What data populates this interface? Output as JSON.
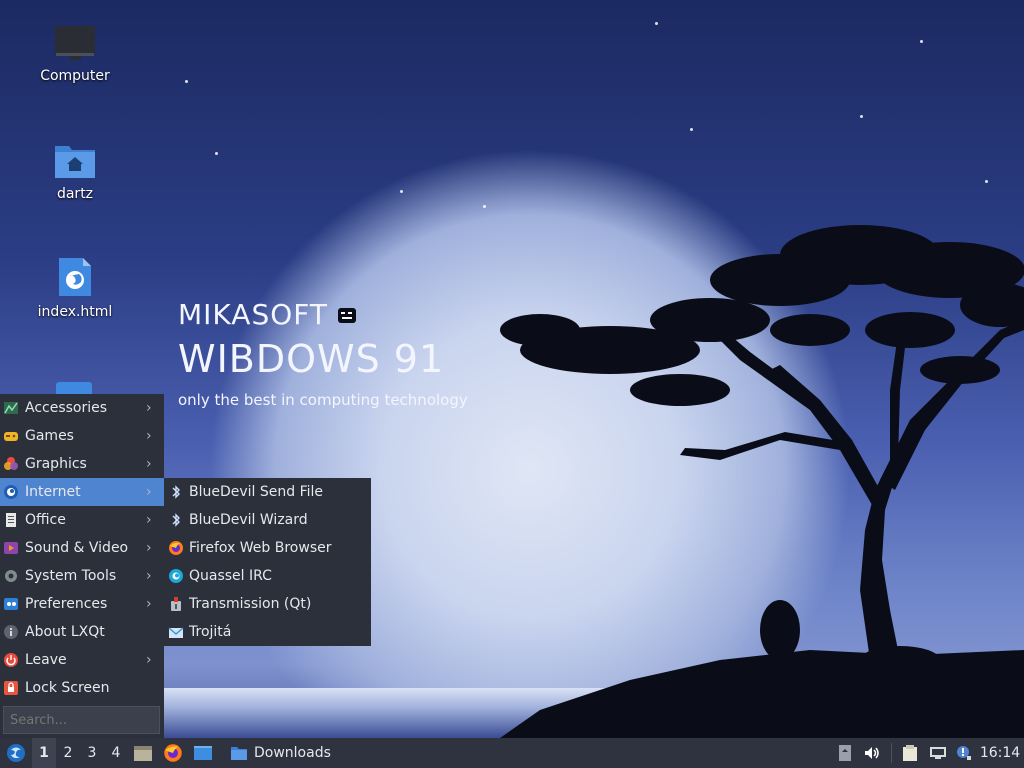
{
  "desktop": {
    "icons": [
      {
        "label": "Computer",
        "icon": "computer-icon"
      },
      {
        "label": "dartz",
        "icon": "home-folder-icon"
      },
      {
        "label": "index.html",
        "icon": "html-file-icon"
      }
    ]
  },
  "wallpaper": {
    "brand": "MIKASOFT",
    "title": "WIBDOWS 91",
    "tagline": "only the best in computing technology"
  },
  "start_menu": {
    "items": [
      {
        "label": "Accessories",
        "icon": "accessories-icon",
        "has_submenu": true
      },
      {
        "label": "Games",
        "icon": "games-icon",
        "has_submenu": true
      },
      {
        "label": "Graphics",
        "icon": "graphics-icon",
        "has_submenu": true
      },
      {
        "label": "Internet",
        "icon": "internet-icon",
        "has_submenu": true,
        "active": true
      },
      {
        "label": "Office",
        "icon": "office-icon",
        "has_submenu": true
      },
      {
        "label": "Sound & Video",
        "icon": "sound-video-icon",
        "has_submenu": true
      },
      {
        "label": "System Tools",
        "icon": "system-tools-icon",
        "has_submenu": true
      },
      {
        "label": "Preferences",
        "icon": "preferences-icon",
        "has_submenu": true
      },
      {
        "label": "About LXQt",
        "icon": "info-icon",
        "has_submenu": false
      },
      {
        "label": "Leave",
        "icon": "power-icon",
        "has_submenu": true
      },
      {
        "label": "Lock Screen",
        "icon": "lock-icon",
        "has_submenu": false
      }
    ],
    "search_placeholder": "Search..."
  },
  "internet_submenu": {
    "items": [
      {
        "label": "BlueDevil Send File",
        "icon": "bluetooth-icon"
      },
      {
        "label": "BlueDevil Wizard",
        "icon": "bluetooth-icon"
      },
      {
        "label": "Firefox Web Browser",
        "icon": "firefox-icon"
      },
      {
        "label": "Quassel IRC",
        "icon": "quassel-icon"
      },
      {
        "label": "Transmission (Qt)",
        "icon": "transmission-icon"
      },
      {
        "label": "Trojitá",
        "icon": "mail-icon"
      }
    ]
  },
  "taskbar": {
    "workspaces": [
      "1",
      "2",
      "3",
      "4"
    ],
    "active_workspace": "1",
    "open_window": "Downloads",
    "clock": "16:14"
  },
  "colors": {
    "menu_bg": "#2b303b",
    "menu_highlight": "#4f84d1",
    "taskbar_bg": "#2e333f"
  }
}
